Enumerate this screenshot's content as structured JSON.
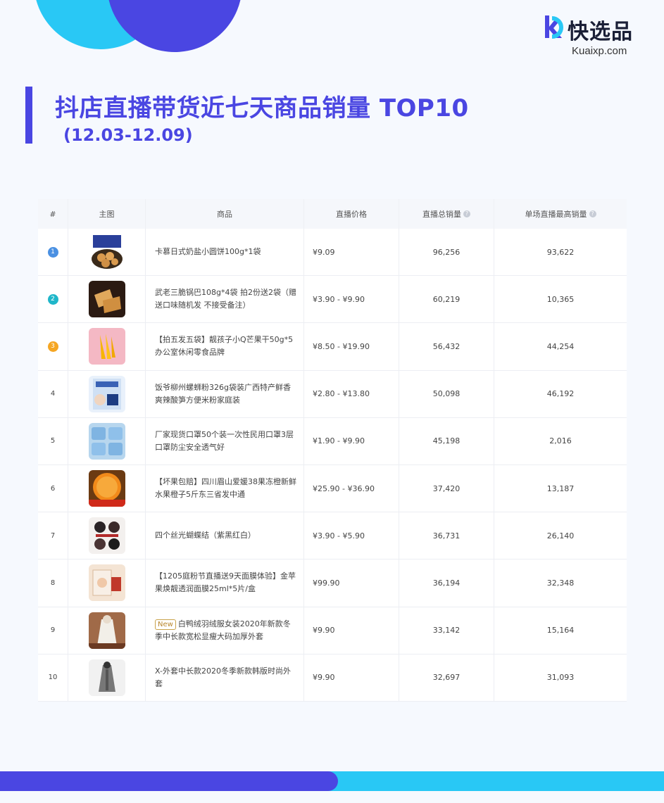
{
  "brand": {
    "name": "快选品",
    "url": "Kuaixp.com"
  },
  "header": {
    "title": "抖店直播带货近七天商品销量 TOP10",
    "date_range": "(12.03-12.09)"
  },
  "colors": {
    "primary": "#4a46e2",
    "accent": "#29c8f5",
    "rank1": "#4a90e2",
    "rank2": "#1fb6c9",
    "rank3": "#f5a623",
    "new_tag": "#c9a24a"
  },
  "table": {
    "columns": {
      "rank": "#",
      "image": "主图",
      "product": "商品",
      "price": "直播价格",
      "total_sales": "直播总销量",
      "max_single": "单场直播最高销量"
    },
    "help_icon": "?",
    "rows": [
      {
        "rank": "1",
        "name": "卡慕日式奶盐小圆饼100g*1袋",
        "tag": "",
        "price": "¥9.09",
        "total": "96,256",
        "max": "93,622",
        "thumb": "biscuit-bag"
      },
      {
        "rank": "2",
        "name": "武老三脆锅巴108g*4袋 拍2份送2袋（赠送口味随机发 不接受备注）",
        "tag": "",
        "price": "¥3.90 - ¥9.90",
        "total": "60,219",
        "max": "10,365",
        "thumb": "crackers"
      },
      {
        "rank": "3",
        "name": "【拍五发五袋】靓孩子小Q芒果干50g*5办公室休闲零食品牌",
        "tag": "",
        "price": "¥8.50 - ¥19.90",
        "total": "56,432",
        "max": "44,254",
        "thumb": "dried-mango"
      },
      {
        "rank": "4",
        "name": "饭爷柳州螺蛳粉326g袋装广西特产鲜香爽辣酸笋方便米粉家庭装",
        "tag": "",
        "price": "¥2.80 - ¥13.80",
        "total": "50,098",
        "max": "46,192",
        "thumb": "noodle-pack"
      },
      {
        "rank": "5",
        "name": "厂家现货口罩50个装一次性民用口罩3层口罩防尘安全透气好",
        "tag": "",
        "price": "¥1.90 - ¥9.90",
        "total": "45,198",
        "max": "2,016",
        "thumb": "masks"
      },
      {
        "rank": "6",
        "name": "【坏果包赔】四川眉山爱媛38果冻橙新鲜水果橙子5斤东三省发中通",
        "tag": "",
        "price": "¥25.90 - ¥36.90",
        "total": "37,420",
        "max": "13,187",
        "thumb": "orange"
      },
      {
        "rank": "7",
        "name": "四个丝光蝴蝶结（紫黑红白）",
        "tag": "",
        "price": "¥3.90 - ¥5.90",
        "total": "36,731",
        "max": "26,140",
        "thumb": "bows"
      },
      {
        "rank": "8",
        "name": "【1205庭粉节直播送9天面膜体验】金苹果焕靓透润面膜25ml*5片/盒",
        "tag": "",
        "price": "¥99.90",
        "total": "36,194",
        "max": "32,348",
        "thumb": "face-mask"
      },
      {
        "rank": "9",
        "name": "白鸭绒羽绒服女装2020年新款冬季中长款宽松显瘦大码加厚外套",
        "tag": "New",
        "price": "¥9.90",
        "total": "33,142",
        "max": "15,164",
        "thumb": "down-coat"
      },
      {
        "rank": "10",
        "name": "X-外套中长款2020冬季新款韩版时尚外套",
        "tag": "",
        "price": "¥9.90",
        "total": "32,697",
        "max": "31,093",
        "thumb": "coat"
      }
    ]
  }
}
